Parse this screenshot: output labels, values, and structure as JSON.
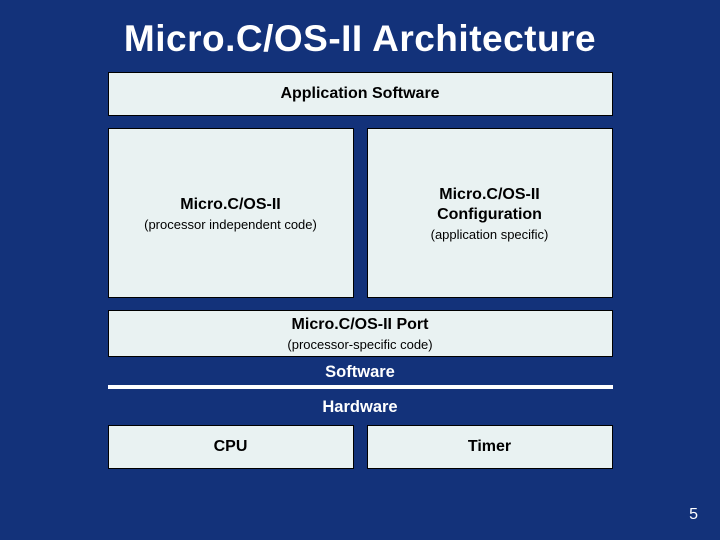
{
  "title": "Micro.C/OS-II Architecture",
  "app": {
    "label": "Application Software"
  },
  "indep": {
    "title": "Micro.C/OS-II",
    "sub": "(processor independent code)"
  },
  "config": {
    "title": "Micro.C/OS-II Configuration",
    "sub": "(application specific)"
  },
  "port": {
    "title": "Micro.C/OS-II Port",
    "sub": "(processor-specific code)"
  },
  "sw_label": "Software",
  "hw_label": "Hardware",
  "cpu": {
    "label": "CPU"
  },
  "timer": {
    "label": "Timer"
  },
  "page": "5"
}
